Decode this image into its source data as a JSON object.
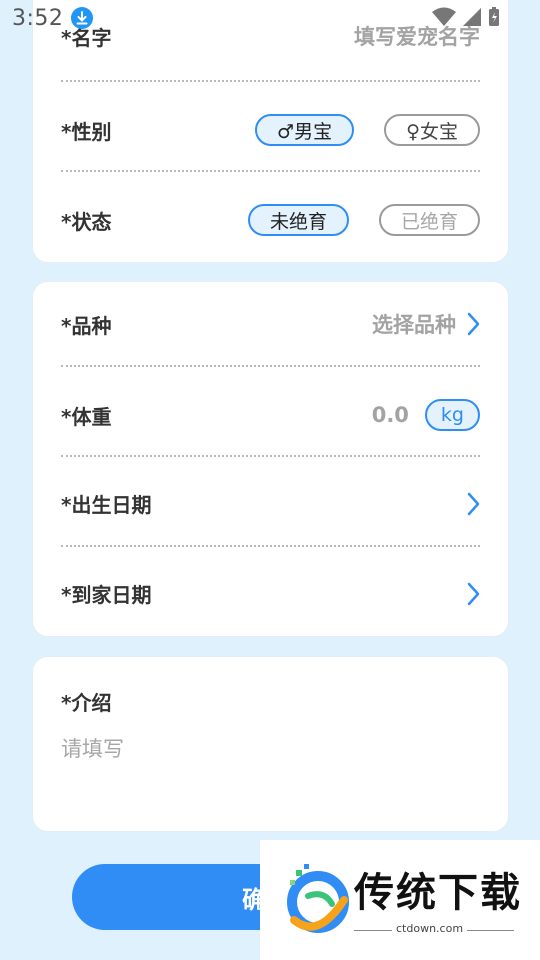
{
  "status": {
    "time": "3:52"
  },
  "card1": {
    "name": {
      "label": "*名字",
      "placeholder": "填写爱宠名字"
    },
    "gender": {
      "label": "*性别",
      "male": "♂男宝",
      "female": "♀女宝",
      "selected": "male"
    },
    "status": {
      "label": "*状态",
      "unneutered": "未绝育",
      "neutered": "已绝育",
      "selected": "unneutered"
    }
  },
  "card2": {
    "breed": {
      "label": "*品种",
      "placeholder": "选择品种"
    },
    "weight": {
      "label": "*体重",
      "value": "0.0",
      "unit": "kg"
    },
    "birth": {
      "label": "*出生日期"
    },
    "arrival": {
      "label": "*到家日期"
    }
  },
  "card3": {
    "label": "*介绍",
    "placeholder": "请填写"
  },
  "confirm": {
    "label": "确"
  },
  "watermark": {
    "title": "传统下载",
    "url": "ctdown.com"
  },
  "colors": {
    "accent": "#2f8df5",
    "background": "#dff1fc"
  }
}
